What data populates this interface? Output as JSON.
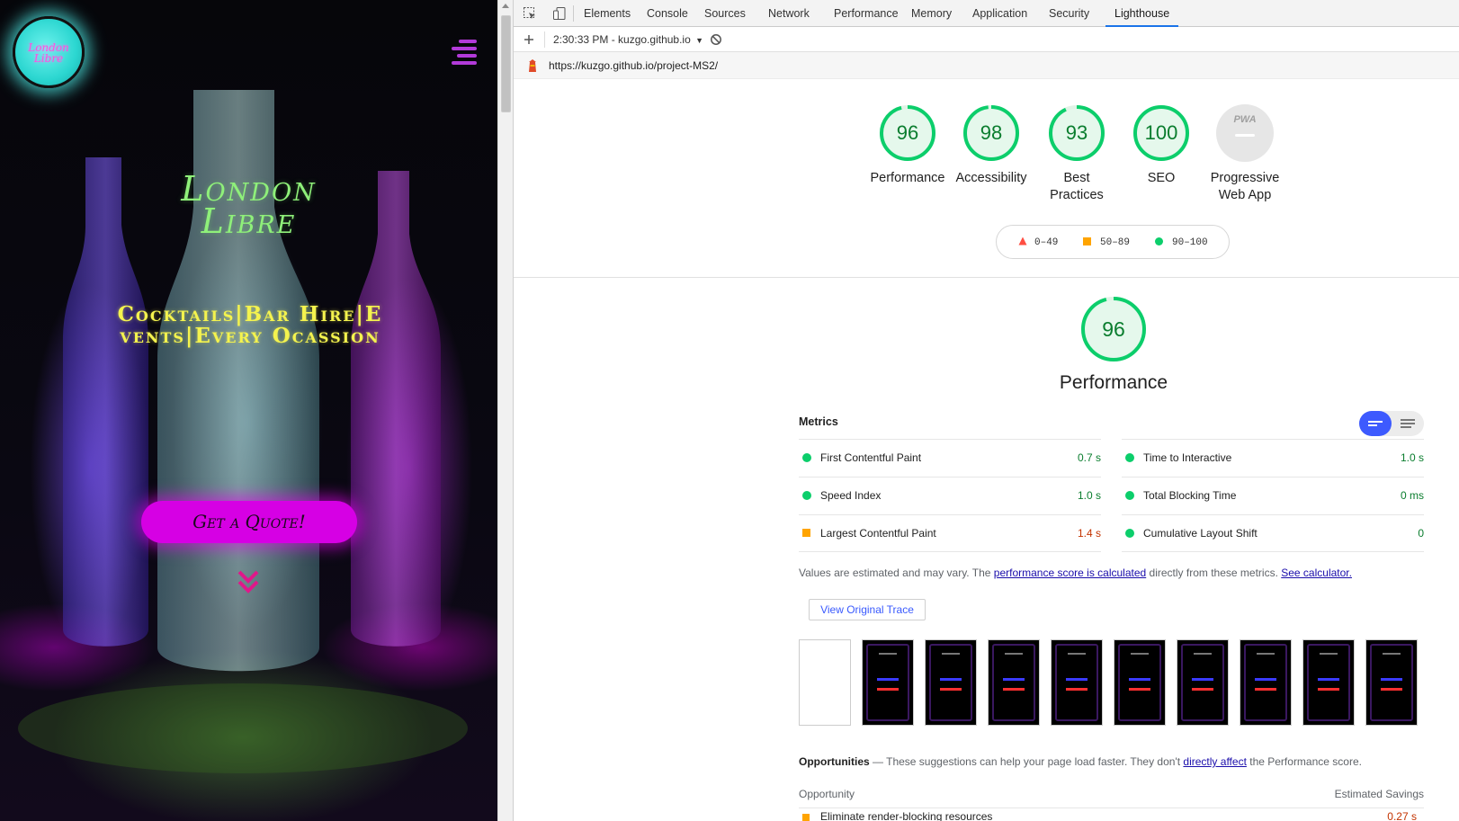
{
  "site": {
    "logo_text": "London Libre",
    "title_line1": "London",
    "title_line2": "Libre",
    "tagline": "Cocktails|Bar Hire|Events|Every Ocassion",
    "quote_button": "Get a Quote!"
  },
  "devtools": {
    "tabs": [
      {
        "label": "Elements"
      },
      {
        "label": "Console"
      },
      {
        "label": "Sources"
      },
      {
        "label": "Network"
      },
      {
        "label": "Performance"
      },
      {
        "label": "Memory"
      },
      {
        "label": "Application"
      },
      {
        "label": "Security"
      },
      {
        "label": "Lighthouse"
      }
    ],
    "active_tab": "Lighthouse",
    "toolbar": {
      "report_select": "2:30:33 PM - kuzgo.github.io"
    },
    "url": "https://kuzgo.github.io/project-MS2/"
  },
  "lighthouse": {
    "scores": [
      {
        "value": "96",
        "label": "Performance",
        "score": 0.96
      },
      {
        "value": "98",
        "label": "Accessibility",
        "score": 0.98
      },
      {
        "value": "93",
        "label_line1": "Best",
        "label_line2": "Practices",
        "score": 0.93
      },
      {
        "value": "100",
        "label": "SEO",
        "score": 1.0
      },
      {
        "badge": "PWA",
        "label_line1": "Progressive",
        "label_line2": "Web App"
      }
    ],
    "legend": {
      "fail": "0–49",
      "average": "50–89",
      "pass": "90–100"
    },
    "performance": {
      "score": "96",
      "score_fraction": 0.96,
      "title": "Performance",
      "metrics_header": "Metrics",
      "metrics": [
        {
          "name": "First Contentful Paint",
          "value": "0.7 s",
          "rating": "pass"
        },
        {
          "name": "Time to Interactive",
          "value": "1.0 s",
          "rating": "pass"
        },
        {
          "name": "Speed Index",
          "value": "1.0 s",
          "rating": "pass"
        },
        {
          "name": "Total Blocking Time",
          "value": "0 ms",
          "rating": "pass"
        },
        {
          "name": "Largest Contentful Paint",
          "value": "1.4 s",
          "rating": "average"
        },
        {
          "name": "Cumulative Layout Shift",
          "value": "0",
          "rating": "pass"
        }
      ],
      "note_prefix": "Values are estimated and may vary. The ",
      "note_link1": "performance score is calculated",
      "note_middle": " directly from these metrics. ",
      "note_link2": "See calculator.",
      "trace_button": "View Original Trace",
      "opportunities_title": "Opportunities",
      "opportunities_prefix": " — These suggestions can help your page load faster. They don't ",
      "opportunities_link": "directly affect",
      "opportunities_suffix": " the Performance score.",
      "opp_col1": "Opportunity",
      "opp_col2": "Estimated Savings",
      "opp_row1": "Eliminate render-blocking resources",
      "opp_row1_value": "0.27 s"
    }
  },
  "colors": {
    "pass": "#0cce6b",
    "average": "#ffa400",
    "fail": "#ff4e42",
    "accent": "#1a73e8"
  }
}
